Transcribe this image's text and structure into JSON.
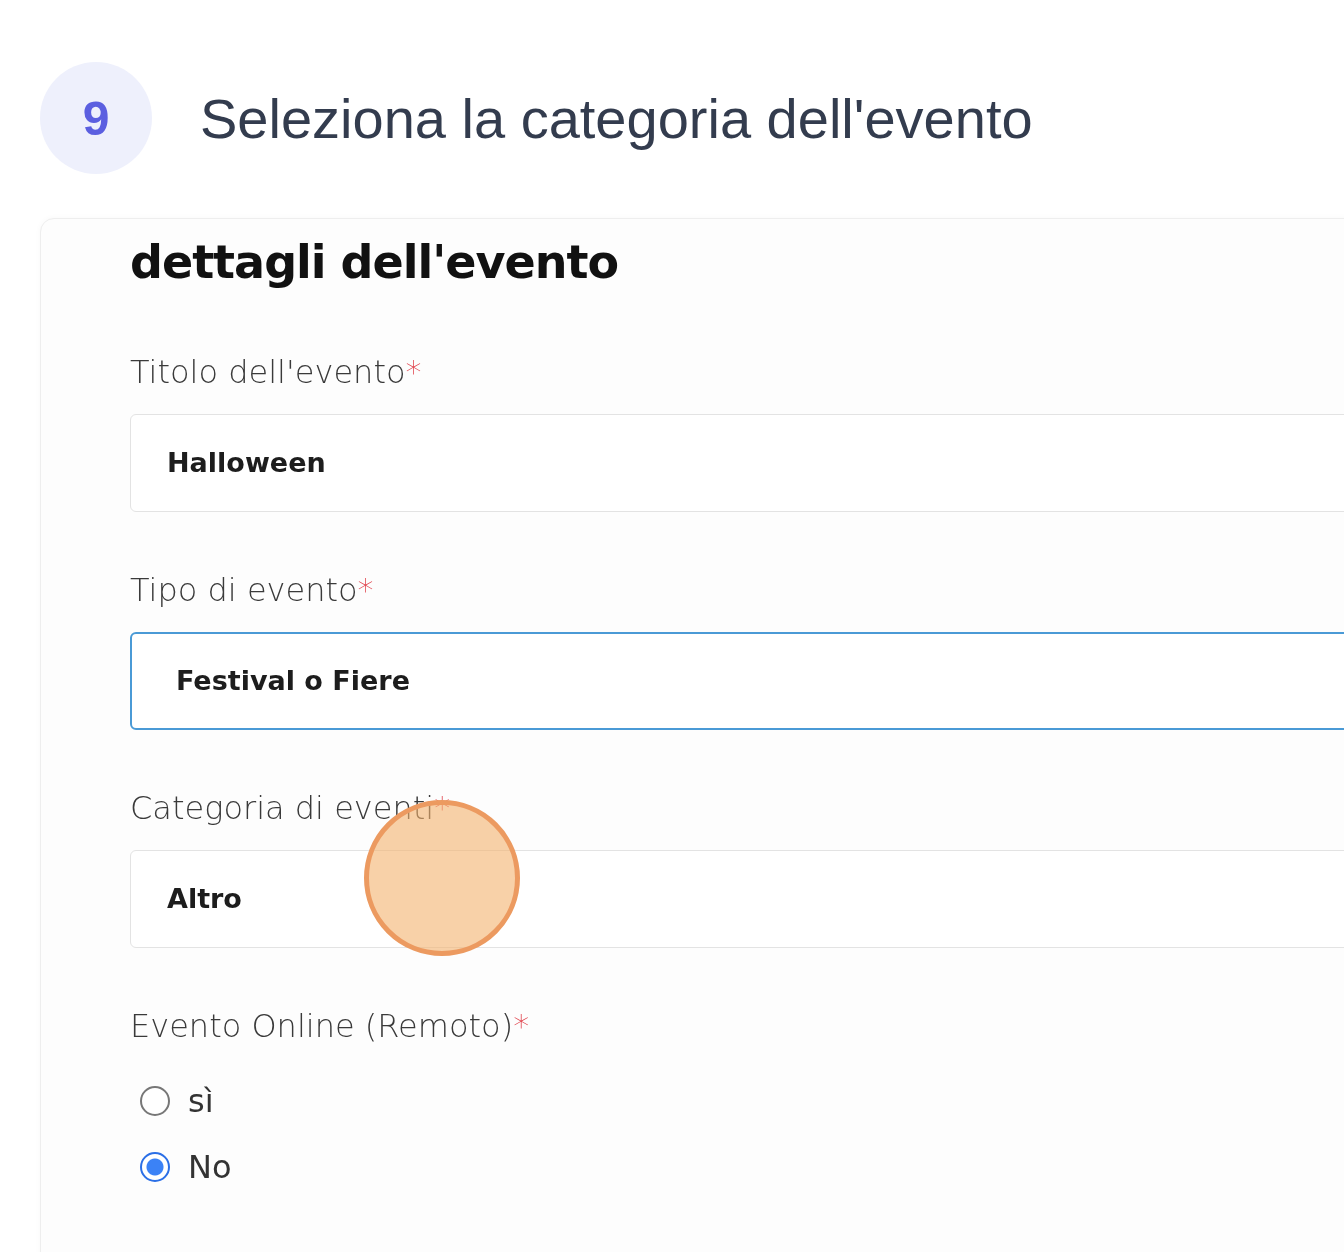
{
  "step": {
    "number": "9",
    "title": "Seleziona la categoria dell'evento"
  },
  "form": {
    "heading": "dettagli dell'evento",
    "fields": [
      {
        "kind": "input",
        "label": "Titolo dell'evento",
        "mark": "*",
        "value": "Halloween",
        "focused": false
      },
      {
        "kind": "select",
        "label": "Tipo di evento",
        "mark": "*",
        "value": "Festival o Fiere",
        "focused": true
      },
      {
        "kind": "select",
        "label": "Categoria di eventi",
        "mark": "*",
        "value": "Altro",
        "focused": false
      },
      {
        "kind": "radio",
        "label": "Evento Online (Remoto)",
        "mark": "*",
        "options": [
          {
            "label": "sì",
            "selected": false
          },
          {
            "label": "No",
            "selected": true
          }
        ]
      }
    ]
  }
}
